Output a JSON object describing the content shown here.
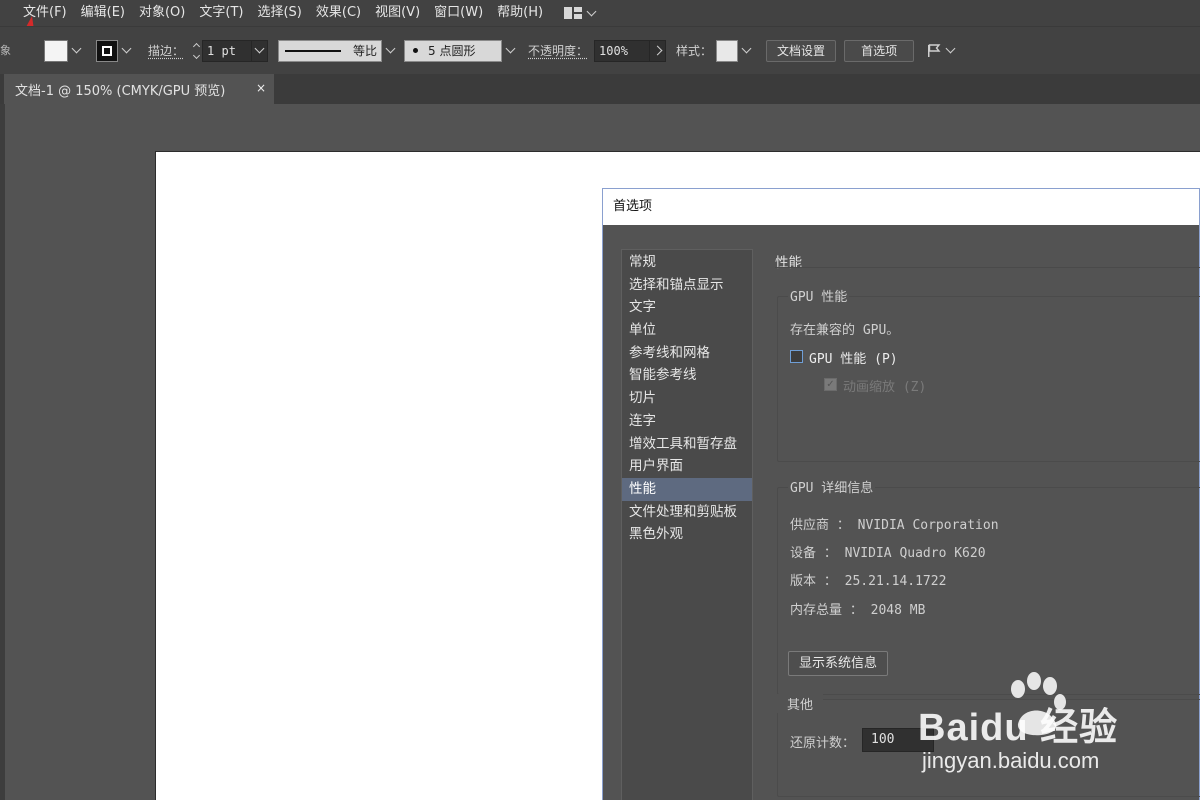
{
  "menubar": {
    "items": [
      "文件(F)",
      "编辑(E)",
      "对象(O)",
      "文字(T)",
      "选择(S)",
      "效果(C)",
      "视图(V)",
      "窗口(W)",
      "帮助(H)"
    ],
    "workspace_icon": "grid-layout-icon"
  },
  "controlbar": {
    "left_edge_char": "象",
    "stroke_label": "描边：",
    "stroke_value": "1 pt",
    "line_profile_label": "等比",
    "brush_value": "5 点圆形",
    "opacity_label": "不透明度：",
    "opacity_value": "100%",
    "style_label": "样式：",
    "doc_setup_button": "文档设置",
    "prefs_button": "首选项"
  },
  "document_tab": {
    "title": "文档-1 @ 150% (CMYK/GPU 预览)",
    "close_glyph": "×"
  },
  "preferences": {
    "title": "首选项",
    "nav": [
      "常规",
      "选择和锚点显示",
      "文字",
      "单位",
      "参考线和网格",
      "智能参考线",
      "切片",
      "连字",
      "增效工具和暂存盘",
      "用户界面",
      "性能",
      "文件处理和剪贴板",
      "黑色外观"
    ],
    "active_nav": "性能",
    "section_title": "性能",
    "gpu_group": {
      "title": "GPU 性能",
      "status": "存在兼容的 GPU。",
      "gpu_checkbox_label": "GPU 性能 (P)",
      "gpu_checked": false,
      "anim_zoom_label": "动画缩放 (Z)",
      "anim_zoom_checked": true
    },
    "gpu_details": {
      "title": "GPU 详细信息",
      "vendor": "供应商 ： NVIDIA Corporation",
      "device": "设备 ： NVIDIA Quadro K620",
      "version": "版本 ： 25.21.14.1722",
      "memory": "内存总量 ： 2048 MB",
      "sysinfo_button": "显示系统信息"
    },
    "other": {
      "title": "其他",
      "undo_label": "还原计数：",
      "undo_value": "100"
    }
  },
  "watermark": {
    "brand": "Baidu 经验",
    "url": "jingyan.baidu.com"
  },
  "colors": {
    "menubar_bg": "#424242",
    "canvas_bg": "#535353",
    "active_nav_bg": "#5e6a80",
    "annotation_arrow": "#d42a2a"
  }
}
